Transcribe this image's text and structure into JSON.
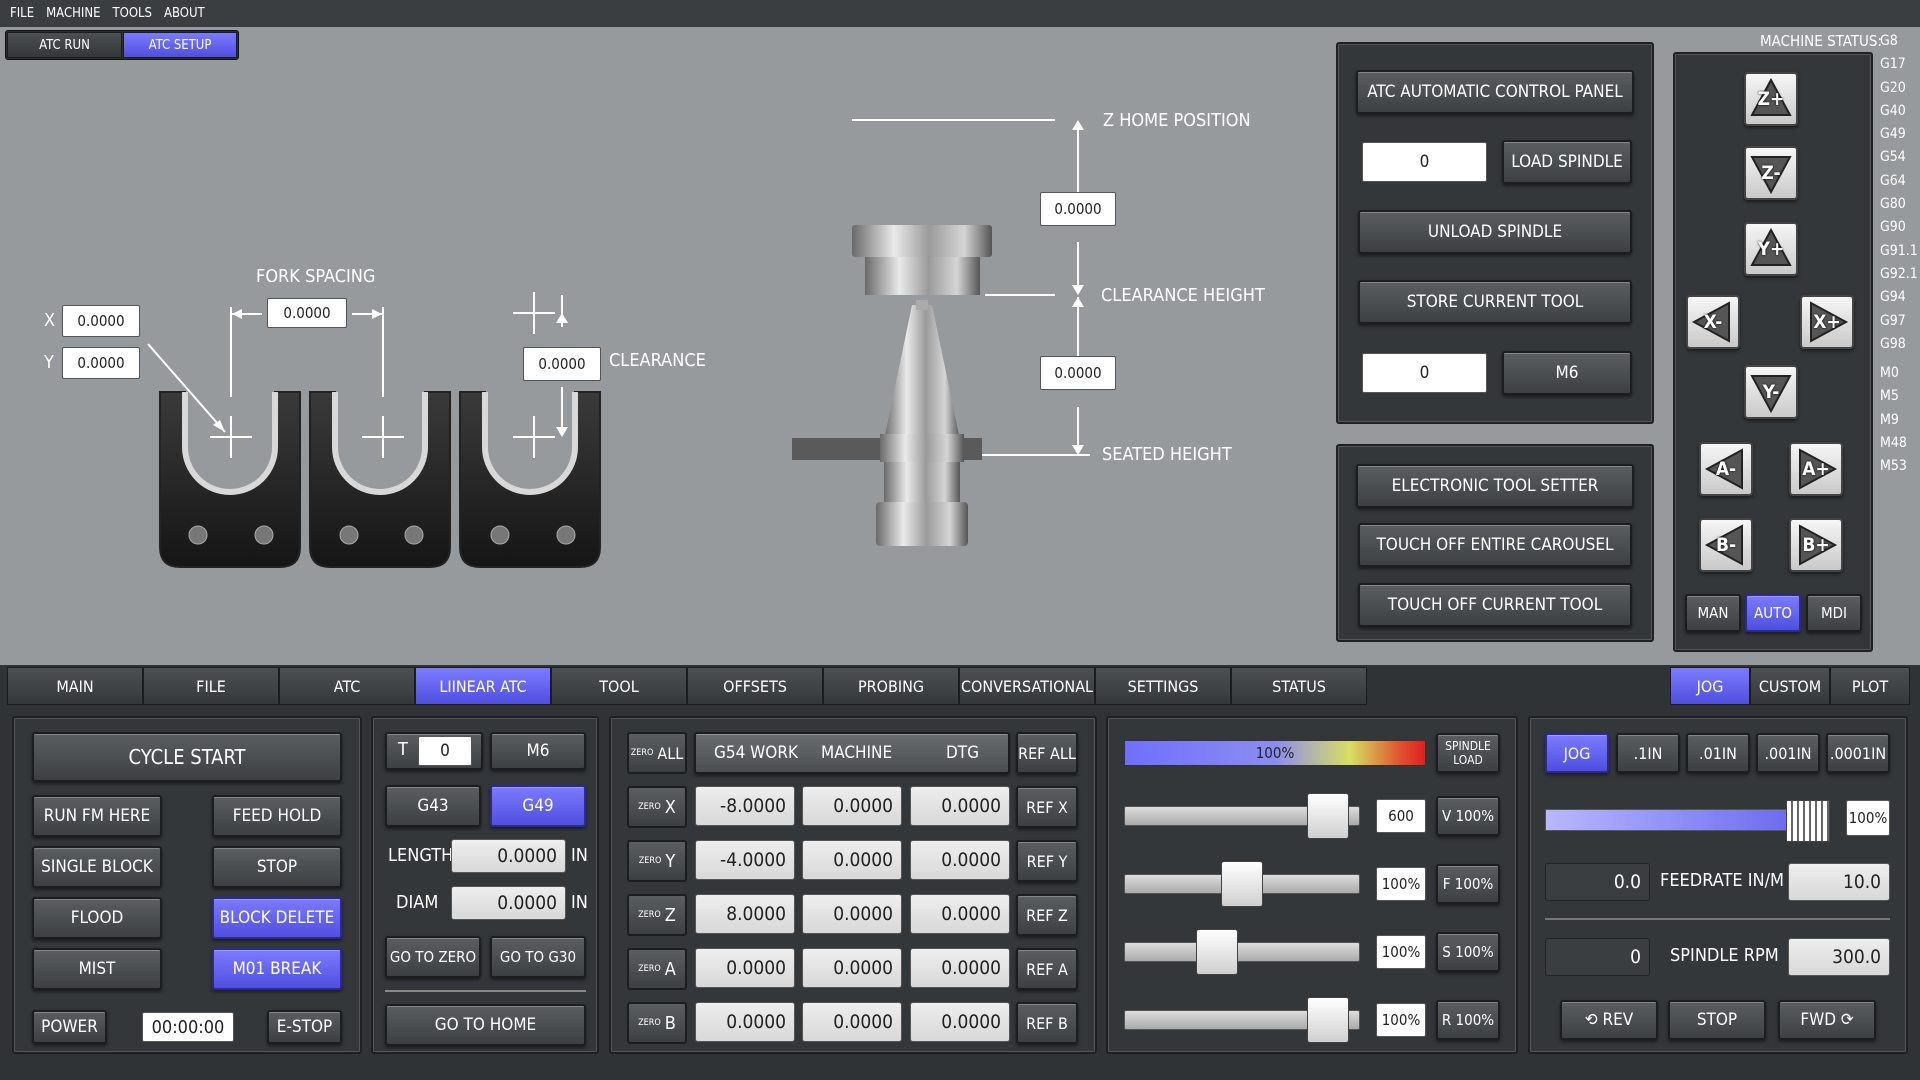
{
  "menu": [
    "FILE",
    "MACHINE",
    "TOOLS",
    "ABOUT"
  ],
  "top_tabs": [
    "ATC RUN",
    "ATC SETUP"
  ],
  "fork": {
    "title": "FORK SPACING",
    "spacing": "0.0000",
    "x_label": "X",
    "x": "0.0000",
    "y_label": "Y",
    "y": "0.0000",
    "clearance_label": "CLEARANCE",
    "clearance": "0.0000"
  },
  "spindle": {
    "z_home": "Z HOME POSITION",
    "z_home_val": "0.0000",
    "clearance_height": "CLEARANCE HEIGHT",
    "seated_val": "0.0000",
    "seated_height": "SEATED HEIGHT"
  },
  "atc_panel": {
    "title": "ATC AUTOMATIC CONTROL PANEL",
    "tool_field": "0",
    "load": "LOAD SPINDLE",
    "unload": "UNLOAD SPINDLE",
    "store": "STORE CURRENT TOOL",
    "m6_field": "0",
    "m6": "M6"
  },
  "tool_setter": {
    "title": "ELECTRONIC TOOL SETTER",
    "carousel": "TOUCH OFF ENTIRE CAROUSEL",
    "current": "TOUCH OFF CURRENT TOOL"
  },
  "machine_status": {
    "label": "MACHINE STATUS:",
    "codes": [
      "G8",
      "G17",
      "G20",
      "G40",
      "G49",
      "G54",
      "G64",
      "G80",
      "G90",
      "G91.1",
      "G92.1",
      "G94",
      "G97",
      "G98",
      "M0",
      "M5",
      "M9",
      "M48",
      "M53"
    ]
  },
  "jog_pad": {
    "z_plus": "Z+",
    "z_minus": "Z-",
    "y_plus": "Y+",
    "x_minus": "X-",
    "x_plus": "X+",
    "y_minus": "Y-",
    "a_minus": "A-",
    "a_plus": "A+",
    "b_minus": "B-",
    "b_plus": "B+",
    "modes": [
      "MAN",
      "AUTO",
      "MDI"
    ]
  },
  "main_tabs": [
    "MAIN",
    "FILE",
    "ATC",
    "LIINEAR ATC",
    "TOOL",
    "OFFSETS",
    "PROBING",
    "CONVERSATIONAL",
    "SETTINGS",
    "STATUS"
  ],
  "right_tabs": [
    "JOG",
    "CUSTOM",
    "PLOT"
  ],
  "cycle": {
    "start": "CYCLE START",
    "run_from": "RUN FM HERE",
    "feed_hold": "FEED HOLD",
    "single_block": "SINGLE BLOCK",
    "stop": "STOP",
    "flood": "FLOOD",
    "block_delete": "BLOCK DELETE",
    "mist": "MIST",
    "m01": "M01 BREAK",
    "power": "POWER",
    "timer": "00:00:00",
    "estop": "E-STOP"
  },
  "tool_ctrl": {
    "t_label": "T",
    "t_value": "0",
    "m6": "M6",
    "g43": "G43",
    "g49": "G49",
    "length_label": "LENGTH",
    "length": "0.0000",
    "diam_label": "DIAM",
    "diam": "0.0000",
    "unit": "IN",
    "go_zero": "GO TO ZERO",
    "go_g30": "GO TO G30",
    "go_home": "GO TO HOME"
  },
  "dro": {
    "zero_all_small": "ZERO",
    "zero_all": "ALL",
    "ref_all": "REF ALL",
    "headers": [
      "G54 WORK",
      "MACHINE",
      "DTG"
    ],
    "rows": [
      {
        "axis": "X",
        "work": "-8.0000",
        "machine": "0.0000",
        "dtg": "0.0000",
        "ref": "REF X"
      },
      {
        "axis": "Y",
        "work": "-4.0000",
        "machine": "0.0000",
        "dtg": "0.0000",
        "ref": "REF Y"
      },
      {
        "axis": "Z",
        "work": "8.0000",
        "machine": "0.0000",
        "dtg": "0.0000",
        "ref": "REF Z"
      },
      {
        "axis": "A",
        "work": "0.0000",
        "machine": "0.0000",
        "dtg": "0.0000",
        "ref": "REF A"
      },
      {
        "axis": "B",
        "work": "0.0000",
        "machine": "0.0000",
        "dtg": "0.0000",
        "ref": "REF B"
      }
    ]
  },
  "overrides": {
    "load_bar": "100%",
    "load_fraction": 1.0,
    "spindle_load": "SPINDLE\nLOAD",
    "rows": [
      {
        "value": "600",
        "btn": "V 100%",
        "fraction": 0.95
      },
      {
        "value": "100%",
        "btn": "F 100%",
        "fraction": 0.5
      },
      {
        "value": "100%",
        "btn": "S 100%",
        "fraction": 0.37
      },
      {
        "value": "100%",
        "btn": "R 100%",
        "fraction": 0.95
      }
    ]
  },
  "jog_panel": {
    "jog": "JOG",
    "increments": [
      ".1IN",
      ".01IN",
      ".001IN",
      ".0001IN"
    ],
    "jog_pct": "100%",
    "jog_fraction": 1.0,
    "feed_actual": "0.0",
    "feed_label": "FEEDRATE IN/M",
    "feed_set": "10.0",
    "rpm_actual": "0",
    "rpm_label": "SPINDLE RPM",
    "rpm_set": "300.0",
    "rev": "⟲ REV",
    "stop": "STOP",
    "fwd": "FWD ⟳"
  }
}
